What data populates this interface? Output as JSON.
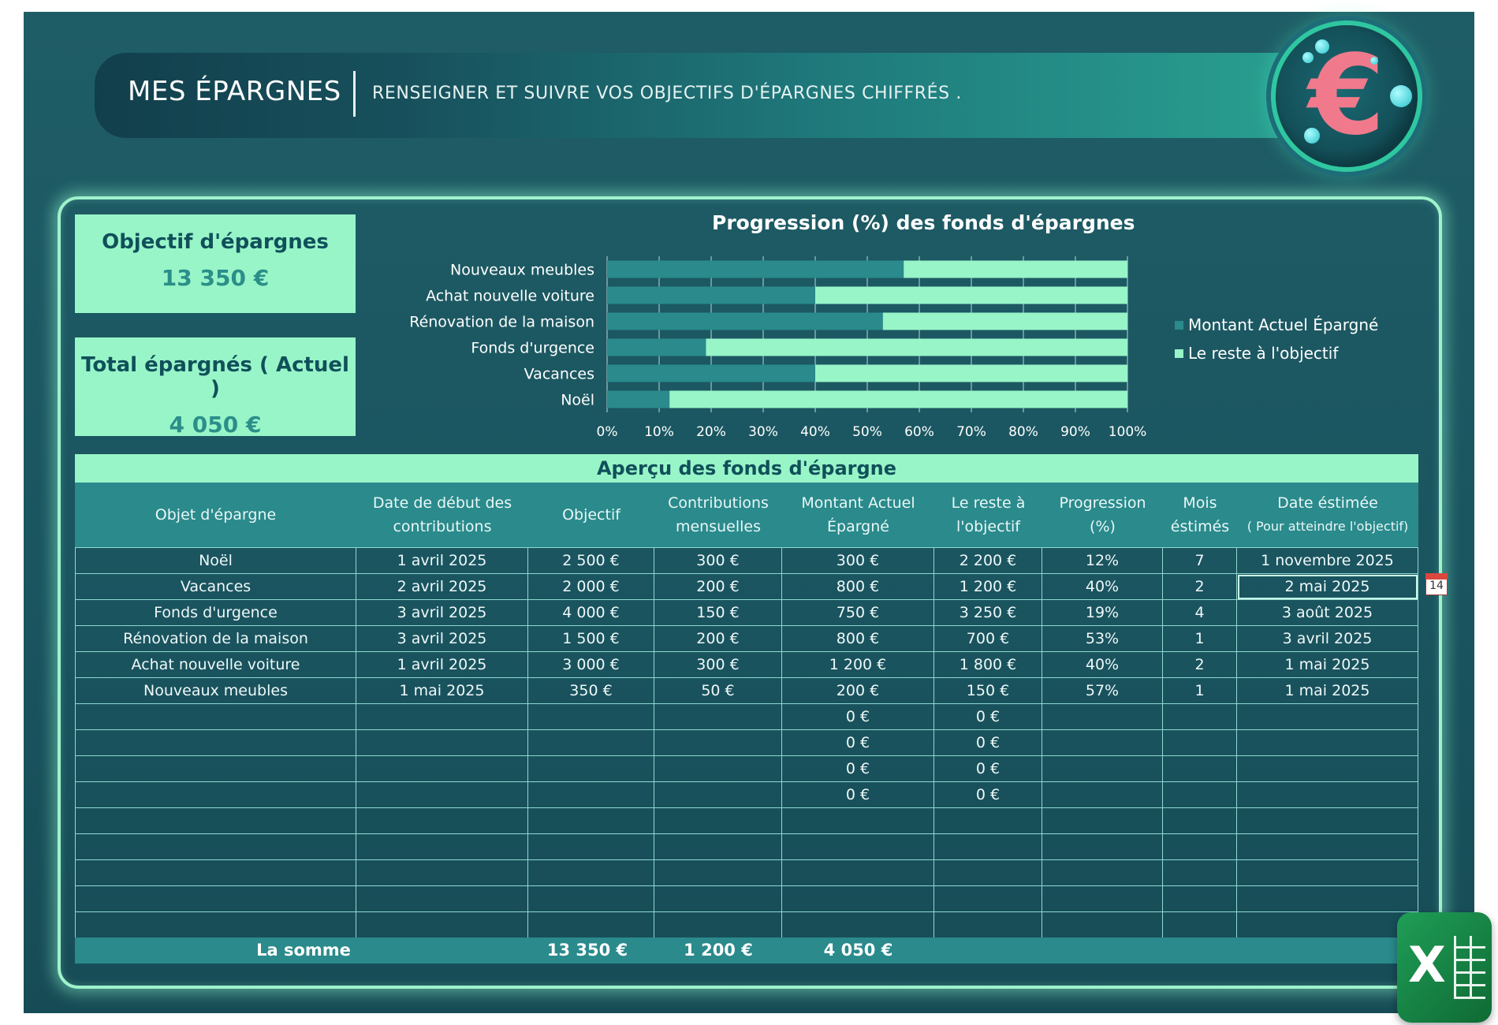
{
  "header": {
    "title": "MES ÉPARGNES",
    "subtitle": "RENSEIGNER ET SUIVRE VOS OBJECTIFS D'ÉPARGNES CHIFFRÉS ."
  },
  "logo": {
    "symbol": "€"
  },
  "cards": {
    "goal_label": "Objectif d'épargnes",
    "goal_value": "13 350 €",
    "total_label": "Total épargnés ( Actuel )",
    "total_value": "4 050 €"
  },
  "colors": {
    "saved": "#2a8a8c",
    "remaining": "#98f5c8",
    "background": "#1a5560"
  },
  "chart_data": {
    "type": "bar",
    "orientation": "horizontal",
    "stacked": "100%",
    "title": "Progression (%) des fonds d'épargnes",
    "categories": [
      "Nouveaux meubles",
      "Achat nouvelle voiture",
      "Rénovation de la maison",
      "Fonds d'urgence",
      "Vacances",
      "Noël"
    ],
    "series": [
      {
        "name": "Montant Actuel Épargné",
        "values": [
          57,
          40,
          53,
          19,
          40,
          12
        ]
      },
      {
        "name": "Le reste à l'objectif",
        "values": [
          43,
          60,
          47,
          81,
          60,
          88
        ]
      }
    ],
    "x_ticks": [
      "0%",
      "10%",
      "20%",
      "30%",
      "40%",
      "50%",
      "60%",
      "70%",
      "80%",
      "90%",
      "100%"
    ],
    "xlim": [
      0,
      100
    ],
    "grid": true,
    "legend": "right"
  },
  "table": {
    "title": "Aperçu des fonds d'épargne",
    "headers": [
      {
        "l1": "Objet d'épargne",
        "l2": ""
      },
      {
        "l1": "Date de début des",
        "l2": "contributions"
      },
      {
        "l1": "Objectif",
        "l2": ""
      },
      {
        "l1": "Contributions",
        "l2": "mensuelles"
      },
      {
        "l1": "Montant Actuel",
        "l2": "Épargné"
      },
      {
        "l1": "Le reste à",
        "l2": "l'objectif"
      },
      {
        "l1": "Progression",
        "l2": "(%)"
      },
      {
        "l1": "Mois",
        "l2": "éstimés"
      },
      {
        "l1": "Date éstimée",
        "l2": "( Pour atteindre l'objectif)"
      }
    ],
    "rows": [
      [
        "Noël",
        "1 avril 2025",
        "2 500 €",
        "300 €",
        "300 €",
        "2 200 €",
        "12%",
        "7",
        "1 novembre 2025"
      ],
      [
        "Vacances",
        "2 avril 2025",
        "2 000 €",
        "200 €",
        "800 €",
        "1 200 €",
        "40%",
        "2",
        "2 mai 2025"
      ],
      [
        "Fonds d'urgence",
        "3 avril 2025",
        "4 000 €",
        "150 €",
        "750 €",
        "3 250 €",
        "19%",
        "4",
        "3 août 2025"
      ],
      [
        "Rénovation de la maison",
        "3 avril 2025",
        "1 500 €",
        "200 €",
        "800 €",
        "700 €",
        "53%",
        "1",
        "3 avril 2025"
      ],
      [
        "Achat nouvelle voiture",
        "1 avril 2025",
        "3 000 €",
        "300 €",
        "1 200 €",
        "1 800 €",
        "40%",
        "2",
        "1 mai 2025"
      ],
      [
        "Nouveaux meubles",
        "1 mai 2025",
        "350 €",
        "50 €",
        "200 €",
        "150 €",
        "57%",
        "1",
        "1 mai 2025"
      ],
      [
        "",
        "",
        "",
        "",
        "0 €",
        "0 €",
        "",
        "",
        ""
      ],
      [
        "",
        "",
        "",
        "",
        "0 €",
        "0 €",
        "",
        "",
        ""
      ],
      [
        "",
        "",
        "",
        "",
        "0 €",
        "0 €",
        "",
        "",
        ""
      ],
      [
        "",
        "",
        "",
        "",
        "0 €",
        "0 €",
        "",
        "",
        ""
      ],
      [
        "",
        "",
        "",
        "",
        "",
        "",
        "",
        "",
        ""
      ],
      [
        "",
        "",
        "",
        "",
        "",
        "",
        "",
        "",
        ""
      ],
      [
        "",
        "",
        "",
        "",
        "",
        "",
        "",
        "",
        ""
      ],
      [
        "",
        "",
        "",
        "",
        "",
        "",
        "",
        "",
        ""
      ],
      [
        "",
        "",
        "",
        "",
        "",
        "",
        "",
        "",
        ""
      ]
    ],
    "totals": {
      "label": "La somme",
      "objectif": "13 350 €",
      "contributions": "1 200 €",
      "montant": "4 050 €"
    }
  },
  "calendar_icon": {
    "day": "14"
  }
}
